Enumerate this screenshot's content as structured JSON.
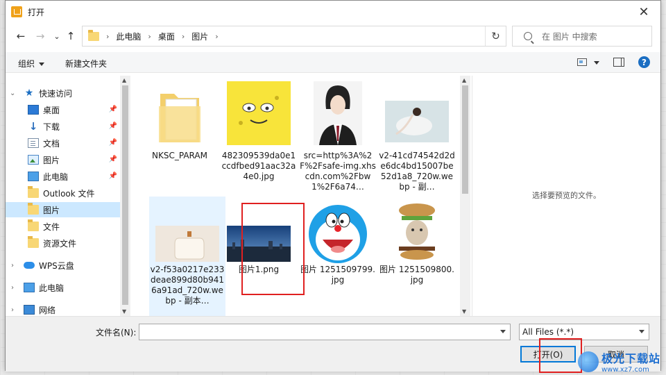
{
  "window": {
    "title": "打开",
    "close_glyph": "✕"
  },
  "nav": {
    "back_glyph": "←",
    "forward_glyph": "→",
    "history_glyph": "⌄",
    "up_glyph": "↑",
    "breadcrumbs": [
      "此电脑",
      "桌面",
      "图片"
    ],
    "crumb_sep": "›",
    "refresh_glyph": "↻",
    "search_placeholder": "在 图片 中搜索"
  },
  "toolbar": {
    "organize": "组织",
    "new_folder": "新建文件夹",
    "help": "?"
  },
  "sidebar": {
    "items": [
      {
        "label": "快速访问",
        "icon": "star-icon",
        "pinned": false
      },
      {
        "label": "桌面",
        "icon": "desktop-icon",
        "pinned": true
      },
      {
        "label": "下载",
        "icon": "download-icon",
        "pinned": true
      },
      {
        "label": "文档",
        "icon": "document-icon",
        "pinned": true
      },
      {
        "label": "图片",
        "icon": "pictures-icon",
        "pinned": true
      },
      {
        "label": "此电脑",
        "icon": "computer-icon",
        "pinned": true
      },
      {
        "label": "Outlook 文件",
        "icon": "folder-icon",
        "pinned": false
      },
      {
        "label": "图片",
        "icon": "folder-icon",
        "pinned": false,
        "selected": true
      },
      {
        "label": "文件",
        "icon": "folder-icon",
        "pinned": false
      },
      {
        "label": "资源文件",
        "icon": "folder-icon",
        "pinned": false
      },
      {
        "label": "WPS云盘",
        "icon": "cloud-icon",
        "pinned": false
      },
      {
        "label": "此电脑",
        "icon": "computer-icon",
        "pinned": false
      },
      {
        "label": "网络",
        "icon": "network-icon",
        "pinned": false
      }
    ]
  },
  "files": [
    {
      "name": "NKSC_PARAM",
      "kind": "folder"
    },
    {
      "name": "482309539da0e1ccdfbed91aac32a4e0.jpg",
      "kind": "sponge"
    },
    {
      "name": "src=http%3A%2F%2Fsafe-img.xhscdn.com%2Fbw1%2F6a74…",
      "kind": "portrait"
    },
    {
      "name": "v2-41cd74542d2de6dc4bd15007be52d1a8_720w.webp - 副…",
      "kind": "dancer"
    },
    {
      "name": "v2-f53a0217e233deae899d80b9416a91ad_720w.webp - 副本…",
      "kind": "bottle",
      "selected": true
    },
    {
      "name": "图片1.png",
      "kind": "skyline"
    },
    {
      "name": "图片 1251509799.jpg",
      "kind": "doraemon"
    },
    {
      "name": "图片 1251509800.jpg",
      "kind": "burger"
    }
  ],
  "preview": {
    "message": "选择要预览的文件。"
  },
  "bottom": {
    "filename_label": "文件名(N):",
    "filename_value": "",
    "filter_value": "All Files (*.*)",
    "open_label": "打开(O)",
    "cancel_label": "取消"
  },
  "watermark": {
    "title": "极光下载站",
    "url": "www.xz7.com"
  },
  "colors": {
    "accent": "#0078d7",
    "highlight": "#e02020",
    "selection": "#cce8ff"
  }
}
